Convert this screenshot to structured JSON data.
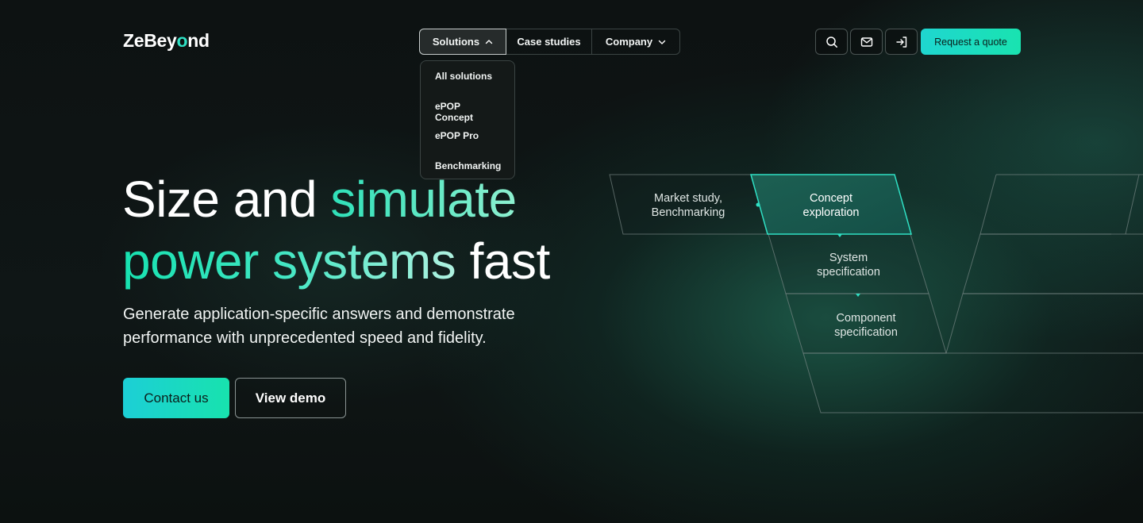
{
  "brand": {
    "logo_text_pre": "ZeBey",
    "logo_text_o": "o",
    "logo_text_post": "nd"
  },
  "nav": {
    "solutions": "Solutions",
    "case_studies": "Case studies",
    "company": "Company"
  },
  "dropdown": {
    "items": [
      "All solutions",
      "ePOP Concept",
      "ePOP Pro",
      "Benchmarking"
    ]
  },
  "header_actions": {
    "search_icon": "search-icon",
    "mail_icon": "mail-icon",
    "login_icon": "login-icon",
    "quote_label": "Request a quote"
  },
  "hero": {
    "title_part1": "Size and ",
    "title_accent1": "simulate",
    "title_accent2": "power systems ",
    "title_tail": "fast",
    "subtitle": "Generate application-specific answers and demonstrate performance with unprecedented speed and fidelity.",
    "contact_label": "Contact us",
    "demo_label": "View demo"
  },
  "process": {
    "steps": [
      {
        "label": "Market study,\nBenchmarking",
        "active": false
      },
      {
        "label": "Concept\nexploration",
        "active": true
      },
      {
        "label": "System\nspecification",
        "active": false
      },
      {
        "label": "Component\nspecification",
        "active": false
      }
    ]
  },
  "colors": {
    "accent": "#1de0b4",
    "accent_cyan": "#1fd6d0",
    "background": "#0d1212",
    "border": "#3b4443"
  }
}
